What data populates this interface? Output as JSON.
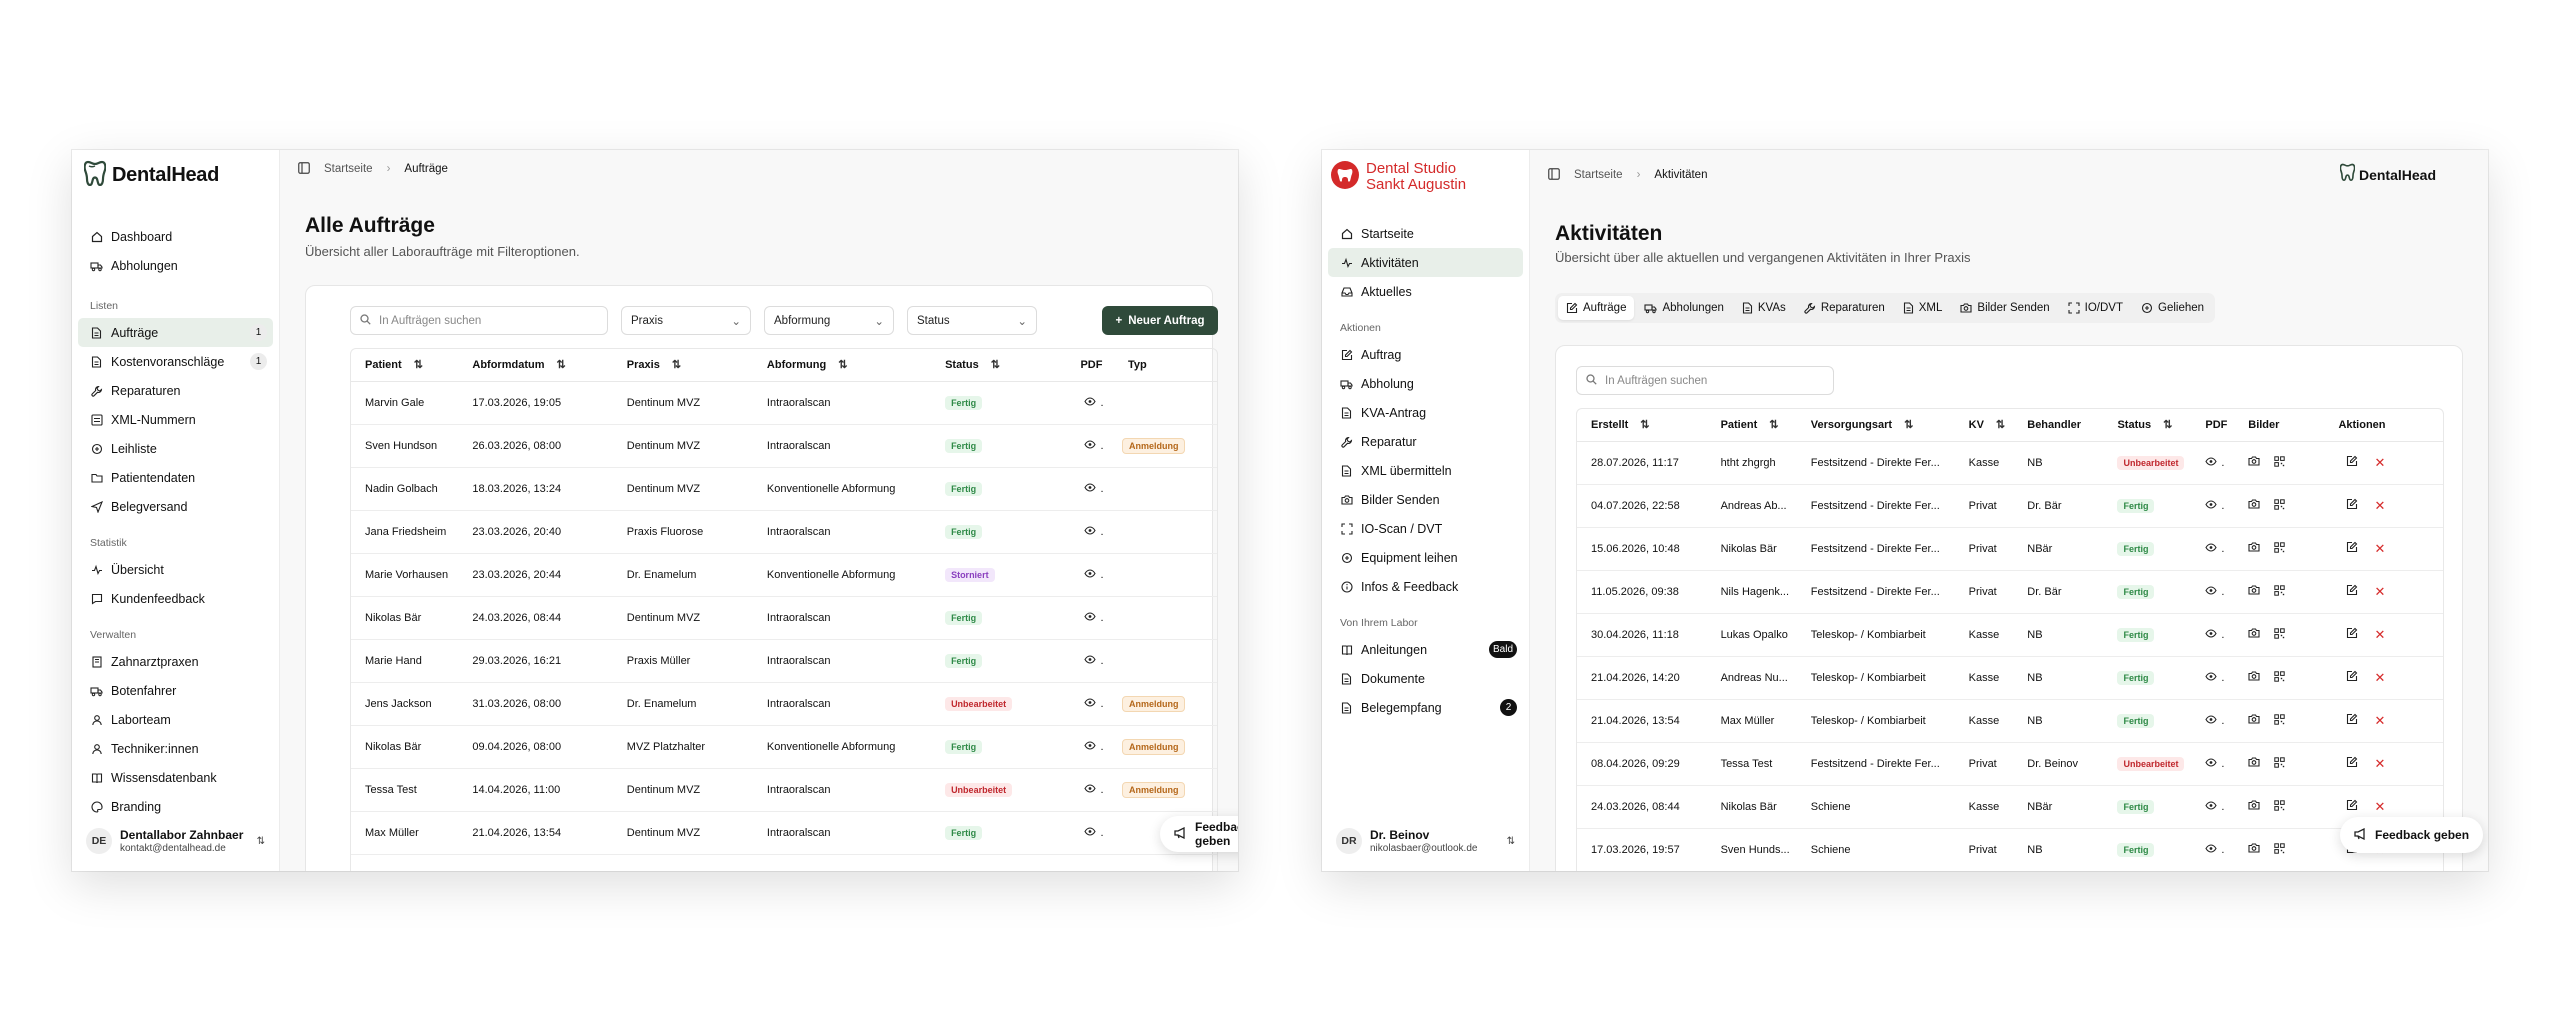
{
  "w1": {
    "brand": "DentalHead",
    "nav_top": [
      {
        "label": "Dashboard",
        "icon": "home-icon"
      },
      {
        "label": "Abholungen",
        "icon": "truck-icon"
      }
    ],
    "sec_listen": "Listen",
    "nav_listen": [
      {
        "label": "Aufträge",
        "icon": "document-icon",
        "count": "1",
        "active": true
      },
      {
        "label": "Kostenvoranschläge",
        "icon": "document-icon",
        "count": "1"
      },
      {
        "label": "Reparaturen",
        "icon": "wrench-icon"
      },
      {
        "label": "XML-Nummern",
        "icon": "list-icon"
      },
      {
        "label": "Leihliste",
        "icon": "loop-icon"
      },
      {
        "label": "Patientendaten",
        "icon": "folder-icon"
      },
      {
        "label": "Belegversand",
        "icon": "send-icon"
      }
    ],
    "sec_statistik": "Statistik",
    "nav_statistik": [
      {
        "label": "Übersicht",
        "icon": "activity-icon"
      },
      {
        "label": "Kundenfeedback",
        "icon": "message-icon"
      }
    ],
    "sec_verwalten": "Verwalten",
    "nav_verwalten": [
      {
        "label": "Zahnarztpraxen",
        "icon": "building-icon"
      },
      {
        "label": "Botenfahrer",
        "icon": "truck-icon"
      },
      {
        "label": "Laborteam",
        "icon": "user-icon"
      },
      {
        "label": "Techniker:innen",
        "icon": "user-icon"
      },
      {
        "label": "Wissensdatenbank",
        "icon": "book-icon"
      },
      {
        "label": "Branding",
        "icon": "palette-icon"
      }
    ],
    "user": {
      "initials": "DE",
      "name": "Dentallabor Zahnbaer",
      "email": "kontakt@dentalhead.de"
    },
    "breadcrumb": {
      "home": "Startseite",
      "current": "Aufträge"
    },
    "title": "Alle Aufträge",
    "subtitle": "Übersicht aller Laboraufträge mit Filteroptionen.",
    "search_placeholder": "In Aufträgen suchen",
    "filters": [
      "Praxis",
      "Abformung",
      "Status"
    ],
    "new_button": "Neuer Auftrag",
    "columns": [
      "Patient",
      "Abformdatum",
      "Praxis",
      "Abformung",
      "Status",
      "PDF",
      "Typ"
    ],
    "rows": [
      {
        "patient": "Marvin Gale",
        "date": "17.03.2026, 19:05",
        "praxis": "Dentinum MVZ",
        "abformung": "Intraoralscan",
        "status": "Fertig",
        "typ": ""
      },
      {
        "patient": "Sven Hundson",
        "date": "26.03.2026, 08:00",
        "praxis": "Dentinum MVZ",
        "abformung": "Intraoralscan",
        "status": "Fertig",
        "typ": "Anmeldung"
      },
      {
        "patient": "Nadin Golbach",
        "date": "18.03.2026, 13:24",
        "praxis": "Dentinum MVZ",
        "abformung": "Konventionelle Abformung",
        "status": "Fertig",
        "typ": ""
      },
      {
        "patient": "Jana Friedsheim",
        "date": "23.03.2026, 20:40",
        "praxis": "Praxis Fluorose",
        "abformung": "Intraoralscan",
        "status": "Fertig",
        "typ": ""
      },
      {
        "patient": "Marie Vorhausen",
        "date": "23.03.2026, 20:44",
        "praxis": "Dr. Enamelum",
        "abformung": "Konventionelle Abformung",
        "status": "Storniert",
        "typ": ""
      },
      {
        "patient": "Nikolas Bär",
        "date": "24.03.2026, 08:44",
        "praxis": "Dentinum MVZ",
        "abformung": "Intraoralscan",
        "status": "Fertig",
        "typ": ""
      },
      {
        "patient": "Marie Hand",
        "date": "29.03.2026, 16:21",
        "praxis": "Praxis Müller",
        "abformung": "Intraoralscan",
        "status": "Fertig",
        "typ": ""
      },
      {
        "patient": "Jens Jackson",
        "date": "31.03.2026, 08:00",
        "praxis": "Dr. Enamelum",
        "abformung": "Intraoralscan",
        "status": "Unbearbeitet",
        "typ": "Anmeldung"
      },
      {
        "patient": "Nikolas Bär",
        "date": "09.04.2026, 08:00",
        "praxis": "MVZ Platzhalter",
        "abformung": "Konventionelle Abformung",
        "status": "Fertig",
        "typ": "Anmeldung"
      },
      {
        "patient": "Tessa Test",
        "date": "14.04.2026, 11:00",
        "praxis": "Dentinum MVZ",
        "abformung": "Intraoralscan",
        "status": "Unbearbeitet",
        "typ": "Anmeldung"
      },
      {
        "patient": "Max Müller",
        "date": "21.04.2026, 13:54",
        "praxis": "Dentinum MVZ",
        "abformung": "Intraoralscan",
        "status": "Fertig",
        "typ": ""
      }
    ],
    "feedback": "Feedback geben"
  },
  "w2": {
    "brand_line1": "Dental Studio",
    "brand_line2": "Sankt Augustin",
    "brand_right": "DentalHead",
    "nav_top": [
      {
        "label": "Startseite",
        "icon": "home-icon"
      },
      {
        "label": "Aktivitäten",
        "icon": "activity-icon",
        "active": true
      },
      {
        "label": "Aktuelles",
        "icon": "inbox-icon"
      }
    ],
    "sec_aktionen": "Aktionen",
    "nav_aktionen": [
      {
        "label": "Auftrag",
        "icon": "edit-icon"
      },
      {
        "label": "Abholung",
        "icon": "truck-icon"
      },
      {
        "label": "KVA-Antrag",
        "icon": "document-icon"
      },
      {
        "label": "Reparatur",
        "icon": "wrench-icon"
      },
      {
        "label": "XML übermitteln",
        "icon": "document-icon"
      },
      {
        "label": "Bilder Senden",
        "icon": "camera-icon"
      },
      {
        "label": "IO-Scan / DVT",
        "icon": "scan-icon"
      },
      {
        "label": "Equipment leihen",
        "icon": "loop-icon"
      },
      {
        "label": "Infos & Feedback",
        "icon": "info-icon"
      }
    ],
    "sec_labor": "Von Ihrem Labor",
    "nav_labor": [
      {
        "label": "Anleitungen",
        "icon": "book-icon",
        "badge": "Bald"
      },
      {
        "label": "Dokumente",
        "icon": "document-icon"
      },
      {
        "label": "Belegempfang",
        "icon": "document-icon",
        "badge": "2"
      }
    ],
    "user": {
      "initials": "DR",
      "name": "Dr. Beinov",
      "email": "nikolasbaer@outlook.de"
    },
    "breadcrumb": {
      "home": "Startseite",
      "current": "Aktivitäten"
    },
    "title": "Aktivitäten",
    "subtitle": "Übersicht über alle aktuellen und vergangenen Aktivitäten in Ihrer Praxis",
    "tabs": [
      {
        "label": "Aufträge",
        "icon": "edit-icon",
        "active": true
      },
      {
        "label": "Abholungen",
        "icon": "truck-icon"
      },
      {
        "label": "KVAs",
        "icon": "document-icon"
      },
      {
        "label": "Reparaturen",
        "icon": "wrench-icon"
      },
      {
        "label": "XML",
        "icon": "document-icon"
      },
      {
        "label": "Bilder Senden",
        "icon": "camera-icon"
      },
      {
        "label": "IO/DVT",
        "icon": "scan-icon"
      },
      {
        "label": "Geliehen",
        "icon": "loop-icon"
      }
    ],
    "search_placeholder": "In Aufträgen suchen",
    "columns": [
      "Erstellt",
      "Patient",
      "Versorgungsart",
      "KV",
      "Behandler",
      "Status",
      "PDF",
      "Bilder",
      "Aktionen"
    ],
    "rows": [
      {
        "date": "28.07.2026, 11:17",
        "patient": "htht zhgrgh",
        "art": "Festsitzend - Direkte Fer...",
        "kv": "Kasse",
        "beh": "NB",
        "status": "Unbearbeitet"
      },
      {
        "date": "04.07.2026, 22:58",
        "patient": "Andreas Ab...",
        "art": "Festsitzend - Direkte Fer...",
        "kv": "Privat",
        "beh": "Dr. Bär",
        "status": "Fertig"
      },
      {
        "date": "15.06.2026, 10:48",
        "patient": "Nikolas Bär",
        "art": "Festsitzend - Direkte Fer...",
        "kv": "Privat",
        "beh": "NBär",
        "status": "Fertig"
      },
      {
        "date": "11.05.2026, 09:38",
        "patient": "Nils Hagenk...",
        "art": "Festsitzend - Direkte Fer...",
        "kv": "Privat",
        "beh": "Dr. Bär",
        "status": "Fertig"
      },
      {
        "date": "30.04.2026, 11:18",
        "patient": "Lukas Opalko",
        "art": "Teleskop- / Kombiarbeit",
        "kv": "Kasse",
        "beh": "NB",
        "status": "Fertig"
      },
      {
        "date": "21.04.2026, 14:20",
        "patient": "Andreas Nu...",
        "art": "Teleskop- / Kombiarbeit",
        "kv": "Kasse",
        "beh": "NB",
        "status": "Fertig"
      },
      {
        "date": "21.04.2026, 13:54",
        "patient": "Max Müller",
        "art": "Teleskop- / Kombiarbeit",
        "kv": "Kasse",
        "beh": "NB",
        "status": "Fertig"
      },
      {
        "date": "08.04.2026, 09:29",
        "patient": "Tessa Test",
        "art": "Festsitzend - Direkte Fer...",
        "kv": "Privat",
        "beh": "Dr. Beinov",
        "status": "Unbearbeitet"
      },
      {
        "date": "24.03.2026, 08:44",
        "patient": "Nikolas Bär",
        "art": "Schiene",
        "kv": "Kasse",
        "beh": "NBär",
        "status": "Fertig"
      },
      {
        "date": "17.03.2026, 19:57",
        "patient": "Sven Hunds...",
        "art": "Schiene",
        "kv": "Privat",
        "beh": "NB",
        "status": "Fertig"
      }
    ],
    "feedback": "Feedback geben"
  },
  "colors": {
    "accent": "#2f4a3a",
    "active_bg": "#e8efe9",
    "fertig": "#2f8a47",
    "unbearbeitet": "#c0282e",
    "storniert": "#8a3fbf",
    "anmeldung": "#b5681b",
    "brand_red": "#d42a2a"
  }
}
